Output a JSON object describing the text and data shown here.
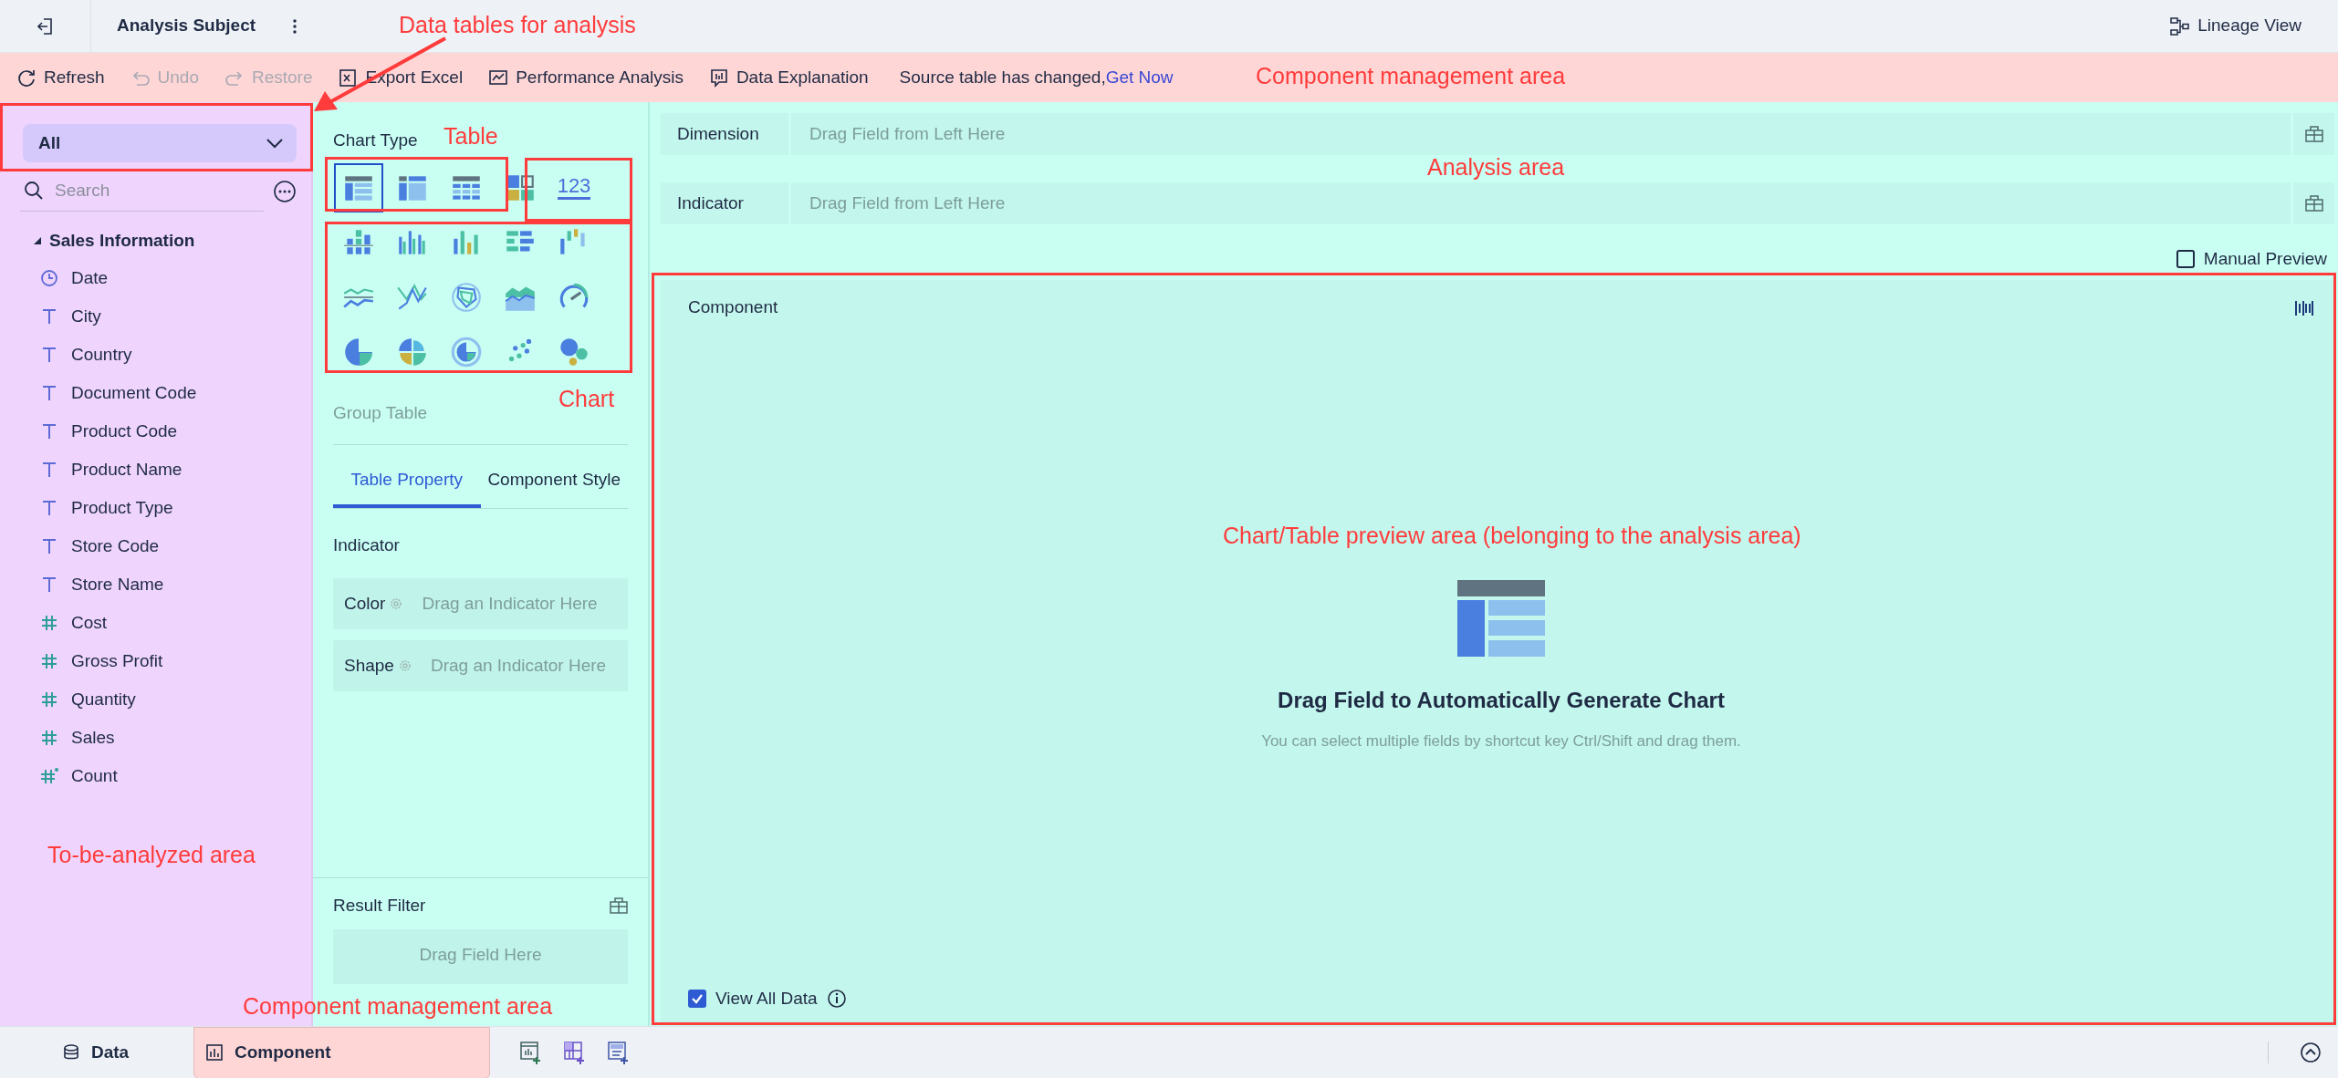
{
  "top_bar": {
    "title": "Analysis Subject",
    "lineage_view": "Lineage View"
  },
  "toolbar": {
    "buttons": [
      {
        "label": "Refresh",
        "kind": "refresh",
        "disabled": false
      },
      {
        "label": "Undo",
        "kind": "undo",
        "disabled": true
      },
      {
        "label": "Restore",
        "kind": "restore",
        "disabled": true
      },
      {
        "label": "Export Excel",
        "kind": "excel",
        "disabled": false
      },
      {
        "label": "Performance Analysis",
        "kind": "performance",
        "disabled": false
      },
      {
        "label": "Data Explanation",
        "kind": "explanation",
        "disabled": false
      }
    ],
    "notice": "Source table has changed,",
    "notice_link": "Get Now"
  },
  "data_panel": {
    "table_select": "All",
    "search": {
      "placeholder": "Search"
    },
    "tree": [
      {
        "label": "Sales Information",
        "expanded": true,
        "children": [
          {
            "label": "Date",
            "kind": "date"
          },
          {
            "label": "City",
            "kind": "text"
          },
          {
            "label": "Country",
            "kind": "text"
          },
          {
            "label": "Document Code",
            "kind": "text"
          },
          {
            "label": "Product Code",
            "kind": "text"
          },
          {
            "label": "Product Name",
            "kind": "text"
          },
          {
            "label": "Product Type",
            "kind": "text"
          },
          {
            "label": "Store Code",
            "kind": "text"
          },
          {
            "label": "Store Name",
            "kind": "text"
          },
          {
            "label": "Cost",
            "kind": "number"
          },
          {
            "label": "Gross Profit",
            "kind": "number"
          },
          {
            "label": "Quantity",
            "kind": "number"
          },
          {
            "label": "Sales",
            "kind": "number"
          },
          {
            "label": "Count",
            "kind": "count"
          }
        ]
      }
    ]
  },
  "chart_panel": {
    "title": "Chart Type",
    "chart_types": [
      {
        "kind": "group-table",
        "selected": true
      },
      {
        "kind": "cross-table",
        "selected": false
      },
      {
        "kind": "detail-table",
        "selected": false
      },
      {
        "kind": "tile",
        "selected": false
      },
      {
        "kind": "kpi",
        "label": "123",
        "selected": false
      },
      {
        "kind": "stacked-bar",
        "selected": false
      },
      {
        "kind": "grouped-bar",
        "selected": false
      },
      {
        "kind": "bar",
        "selected": false
      },
      {
        "kind": "horizontal-bar",
        "selected": false
      },
      {
        "kind": "waterfall",
        "selected": false
      },
      {
        "kind": "line",
        "selected": false
      },
      {
        "kind": "polyline",
        "selected": false
      },
      {
        "kind": "radar",
        "selected": false
      },
      {
        "kind": "area",
        "selected": false
      },
      {
        "kind": "gauge",
        "selected": false
      },
      {
        "kind": "pie",
        "selected": false
      },
      {
        "kind": "rose",
        "selected": false
      },
      {
        "kind": "ring",
        "selected": false
      },
      {
        "kind": "scatter",
        "selected": false
      },
      {
        "kind": "bubble",
        "selected": false
      }
    ],
    "selected_type_name": "Group Table",
    "tabs": [
      {
        "label": "Table Property",
        "selected": true
      },
      {
        "label": "Component Style",
        "selected": false
      }
    ],
    "section_title": "Indicator",
    "drop_slots": [
      {
        "label": "Color",
        "hint": "Drag an Indicator Here"
      },
      {
        "label": "Shape",
        "hint": "Drag an Indicator Here"
      }
    ],
    "result_filter": {
      "title": "Result Filter",
      "hint": "Drag Field Here"
    }
  },
  "analysis": {
    "shelves": [
      {
        "label": "Dimension",
        "hint": "Drag Field from Left Here"
      },
      {
        "label": "Indicator",
        "hint": "Drag Field from Left Here"
      }
    ],
    "manual_preview": {
      "label": "Manual Preview",
      "checked": false
    },
    "component": {
      "title": "Component",
      "empty_title": "Drag Field to Automatically Generate Chart",
      "empty_hint": "You can select multiple fields by shortcut key Ctrl/Shift and drag them.",
      "view_all_data": {
        "label": "View All Data",
        "checked": true
      }
    }
  },
  "bottom_tabs": [
    {
      "label": "Data",
      "kind": "data",
      "selected": false
    },
    {
      "label": "Component",
      "kind": "component",
      "selected": true
    }
  ],
  "annotations": [
    {
      "text": "Data tables for analysis"
    },
    {
      "text": "Component management area"
    },
    {
      "text": "Table"
    },
    {
      "text": "Analysis area"
    },
    {
      "text": "Chart"
    },
    {
      "text": "Chart/Table preview area (belonging to the analysis area)"
    },
    {
      "text": "To-be-analyzed area"
    },
    {
      "text": "Component management area"
    }
  ]
}
